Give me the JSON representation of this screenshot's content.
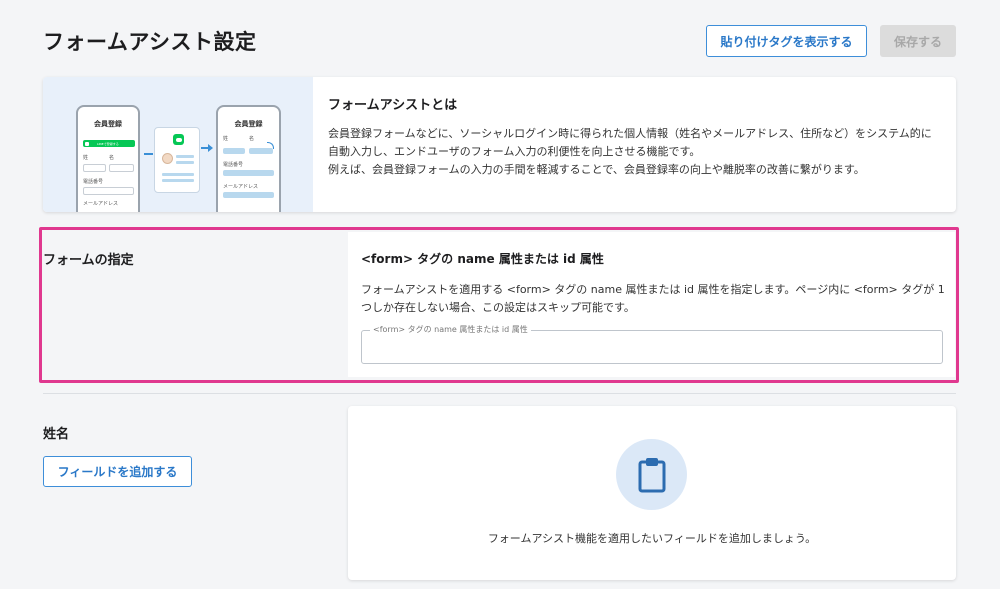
{
  "header": {
    "title": "フォームアシスト設定",
    "show_tag_button": "貼り付けタグを表示する",
    "save_button": "保存する"
  },
  "about": {
    "title": "フォームアシストとは",
    "line1": "会員登録フォームなどに、ソーシャルログイン時に得られた個人情報（姓名やメールアドレス、住所など）をシステム的に自動入力し、エンドユーザのフォーム入力の利便性を向上させる機能です。",
    "line2": "例えば、会員登録フォームの入力の手間を軽減することで、会員登録率の向上や離脱率の改善に繋がります。",
    "illustration": {
      "left_phone_title": "会員登録",
      "line_button": "LINEで登録する",
      "left_labels": [
        "姓",
        "名",
        "電話番号",
        "メールアドレス"
      ],
      "right_phone_title": "会員登録",
      "right_labels": [
        "姓",
        "名",
        "電話番号",
        "メールアドレス"
      ],
      "middle_icon": "line-app-icon"
    }
  },
  "form_spec": {
    "section_label": "フォームの指定",
    "card_title": "<form> タグの name 属性または id 属性",
    "description": "フォームアシストを適用する <form> タグの name 属性または id 属性を指定します。ページ内に <form> タグが 1 つしか存在しない場合、この設定はスキップ可能です。",
    "field_label": "<form> タグの name 属性または id 属性",
    "field_value": ""
  },
  "name_section": {
    "section_label": "姓名",
    "add_field_button": "フィールドを追加する",
    "empty_icon": "clipboard-icon",
    "empty_message": "フォームアシスト機能を適用したいフィールドを追加しましょう。"
  },
  "colors": {
    "accent": "#2a78c8",
    "highlight_border": "#e0388f",
    "line_green": "#06c755",
    "icon_bg": "#dbe8f7",
    "icon_fg": "#2c6cb0"
  }
}
